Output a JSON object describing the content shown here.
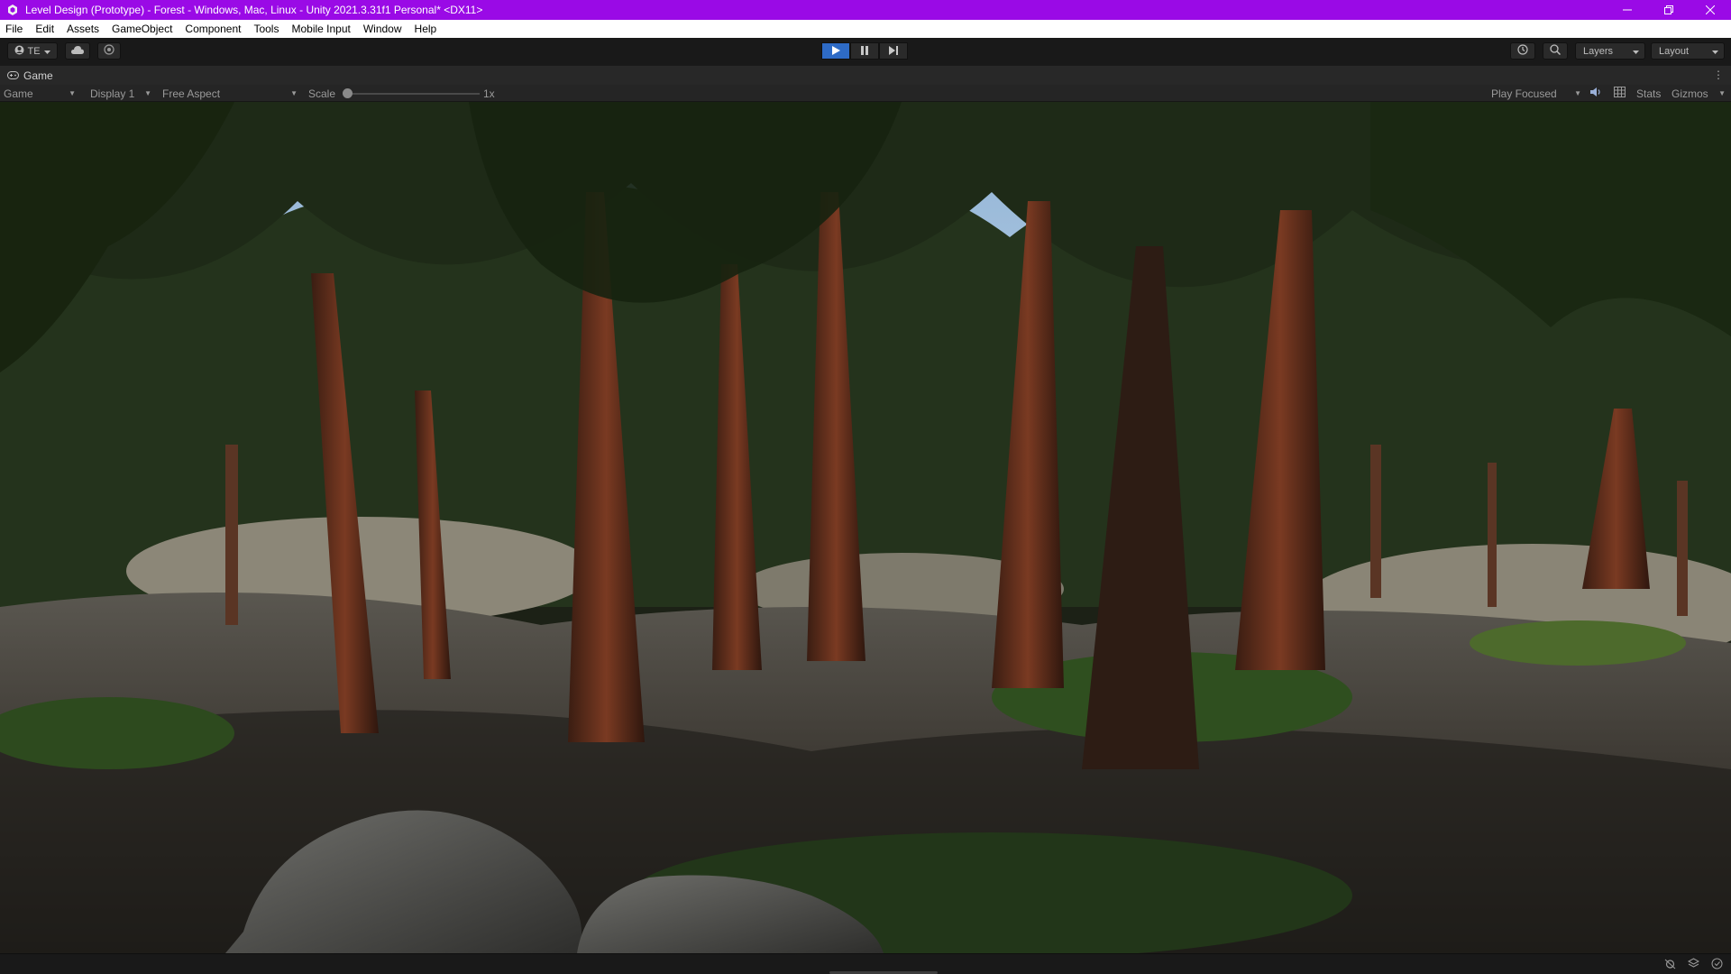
{
  "window": {
    "title": "Level Design (Prototype) - Forest - Windows, Mac, Linux - Unity 2021.3.31f1 Personal* <DX11>"
  },
  "menu": {
    "items": [
      "File",
      "Edit",
      "Assets",
      "GameObject",
      "Component",
      "Tools",
      "Mobile Input",
      "Window",
      "Help"
    ]
  },
  "toolbar": {
    "account_label": "TE",
    "layers_label": "Layers",
    "layout_label": "Layout"
  },
  "game_tab": {
    "label": "Game"
  },
  "game_view_toolbar": {
    "view_mode": "Game",
    "display": "Display 1",
    "aspect": "Free Aspect",
    "scale_label": "Scale",
    "scale_value": "1x",
    "play_mode": "Play Focused",
    "stats_label": "Stats",
    "gizmos_label": "Gizmos"
  },
  "colors": {
    "titlebar": "#9a0ae6",
    "play_active": "#2e6bc6",
    "editor_bg": "#191919"
  },
  "icons": {
    "app": "unity-logo-icon",
    "account": "account-icon",
    "cloud": "cloud-icon",
    "collab": "collab-icon",
    "play": "play-icon",
    "pause": "pause-icon",
    "step": "step-icon",
    "history": "history-icon",
    "search": "search-icon",
    "mute": "speaker-icon",
    "grid": "grid-icon"
  }
}
